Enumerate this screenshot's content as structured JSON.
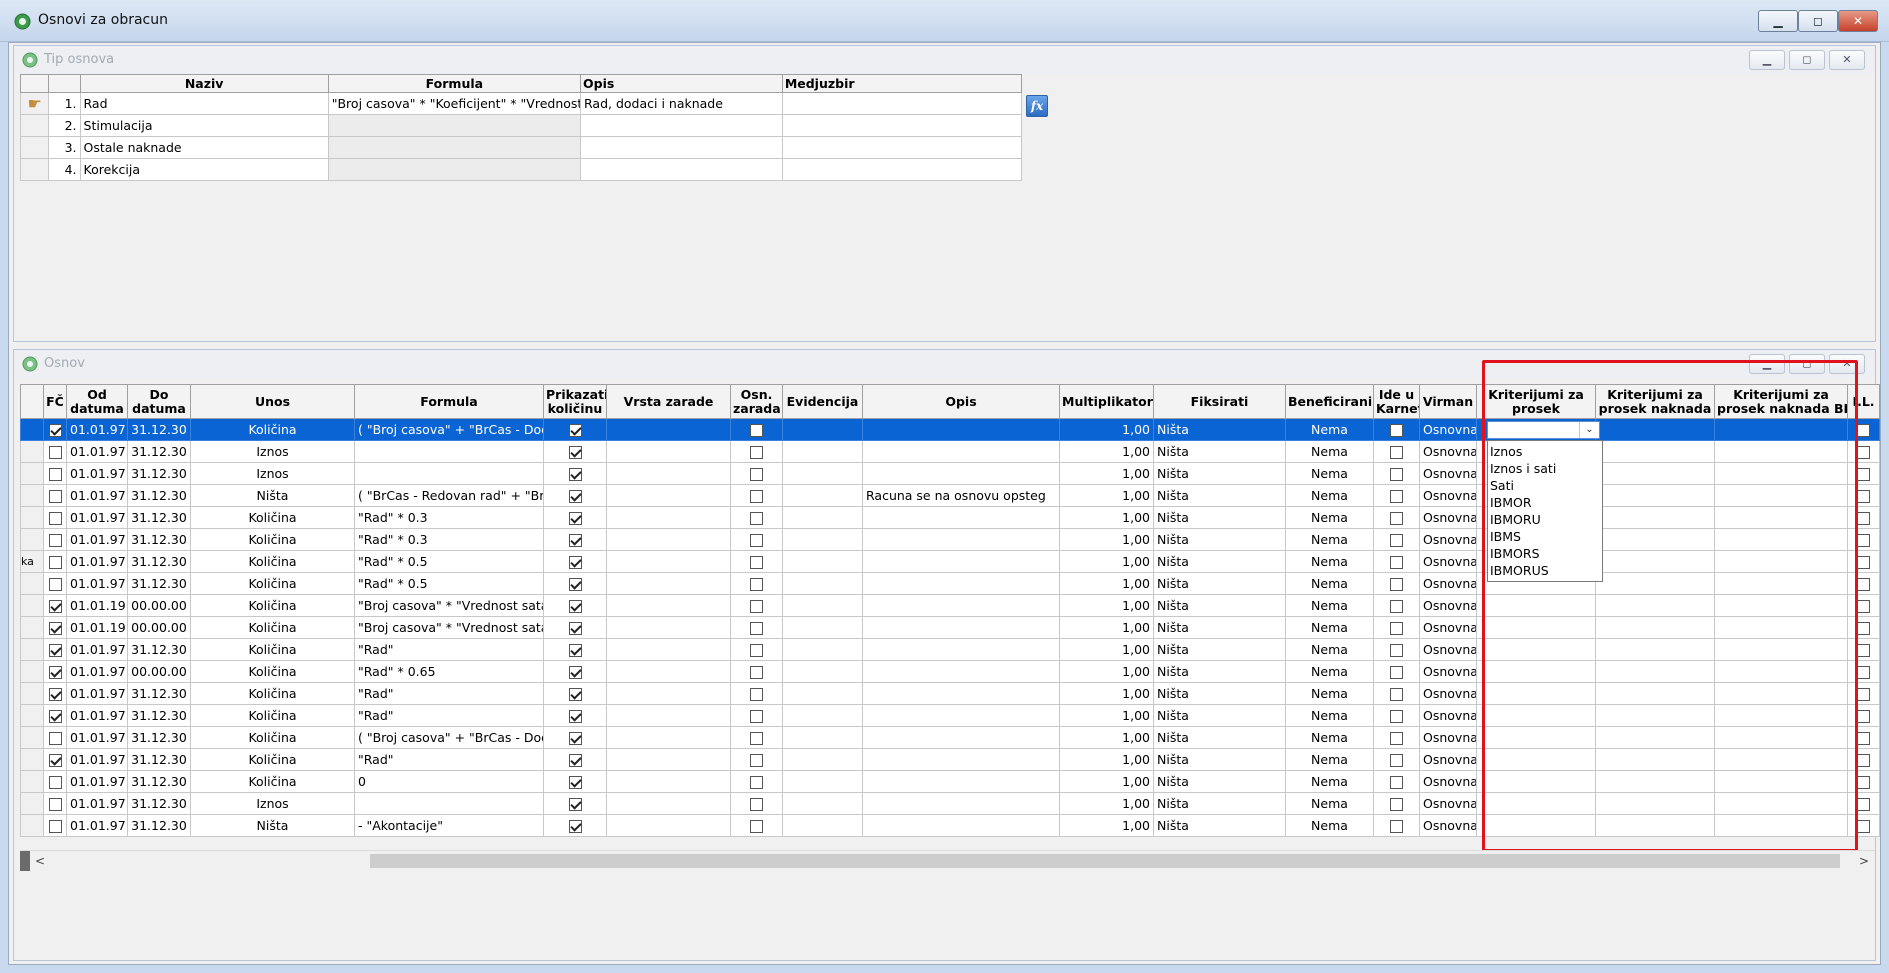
{
  "window": {
    "title": "Osnovi za obracun",
    "btn_min": "▁",
    "btn_max": "◻",
    "btn_close": "✕"
  },
  "tip_osnova": {
    "title": "Tip osnova",
    "columns": [
      "Naziv",
      "Formula",
      "Opis",
      "Medjuzbir"
    ],
    "rows": [
      {
        "num": "1.",
        "naziv": "Rad",
        "formula": "\"Broj casova\" *  \"Koeficijent\" *  \"Vrednost b",
        "opis": "Rad, dodaci i naknade",
        "medjuzbir": ""
      },
      {
        "num": "2.",
        "naziv": "Stimulacija",
        "formula": "",
        "opis": "",
        "medjuzbir": ""
      },
      {
        "num": "3.",
        "naziv": "Ostale naknade",
        "formula": "",
        "opis": "",
        "medjuzbir": ""
      },
      {
        "num": "4.",
        "naziv": "Korekcija",
        "formula": "",
        "opis": "",
        "medjuzbir": ""
      }
    ],
    "fx_label": "fx"
  },
  "osnov": {
    "title": "Osnov",
    "columns": {
      "fc": "FČ",
      "od": [
        "Od",
        "datuma"
      ],
      "do": [
        "Do",
        "datuma"
      ],
      "unos": "Unos",
      "formula": "Formula",
      "prikazati": [
        "Prikazati",
        "količinu"
      ],
      "vrsta": "Vrsta zarade",
      "osn": [
        "Osn.",
        "zarada"
      ],
      "evidencija": "Evidencija",
      "opis": "Opis",
      "multiplikator": "Multiplikator",
      "fiksirati": "Fiksirati",
      "beneficirani": "Beneficirani",
      "ide": [
        "Ide u",
        "Karnet"
      ],
      "virman": "Virman",
      "krit1": [
        "Kriterijumi za",
        "prosek"
      ],
      "krit2": [
        "Kriterijumi za",
        "prosek naknada"
      ],
      "krit3": [
        "Kriterijumi za",
        "prosek naknada BD"
      ],
      "il": "I.L."
    },
    "rows": [
      {
        "fc": true,
        "od": "01.01.97",
        "do": "31.12.30",
        "unos": "Količina",
        "formula": "(  \"Broj casova\" + \"BrCas - Dodat",
        "prik": true,
        "osn": false,
        "opis": "",
        "mult": "1,00",
        "fiks": "Ništa",
        "ben": "Nema",
        "ide": false,
        "virman": "Osnovna",
        "il": false,
        "left": ""
      },
      {
        "fc": false,
        "od": "01.01.97",
        "do": "31.12.30",
        "unos": "Iznos",
        "formula": "",
        "prik": true,
        "osn": false,
        "opis": "",
        "mult": "1,00",
        "fiks": "Ništa",
        "ben": "Nema",
        "ide": false,
        "virman": "Osnovna",
        "il": false,
        "left": ""
      },
      {
        "fc": false,
        "od": "01.01.97",
        "do": "31.12.30",
        "unos": "Iznos",
        "formula": "",
        "prik": true,
        "osn": false,
        "opis": "",
        "mult": "1,00",
        "fiks": "Ništa",
        "ben": "Nema",
        "ide": false,
        "virman": "Osnovna",
        "il": false,
        "left": ""
      },
      {
        "fc": false,
        "od": "01.01.97",
        "do": "31.12.30",
        "unos": "Ništa",
        "formula": "(  \"BrCas - Redovan rad\" + \"BrCa",
        "prik": true,
        "osn": false,
        "opis": "Racuna se na osnovu opsteg",
        "mult": "1,00",
        "fiks": "Ništa",
        "ben": "Nema",
        "ide": false,
        "virman": "Osnovna",
        "il": false,
        "left": ""
      },
      {
        "fc": false,
        "od": "01.01.97",
        "do": "31.12.30",
        "unos": "Količina",
        "formula": "\"Rad\" * 0.3",
        "prik": true,
        "osn": false,
        "opis": "",
        "mult": "1,00",
        "fiks": "Ništa",
        "ben": "Nema",
        "ide": false,
        "virman": "Osnovna",
        "il": false,
        "left": ""
      },
      {
        "fc": false,
        "od": "01.01.97",
        "do": "31.12.30",
        "unos": "Količina",
        "formula": "\"Rad\" * 0.3",
        "prik": true,
        "osn": false,
        "opis": "",
        "mult": "1,00",
        "fiks": "Ništa",
        "ben": "Nema",
        "ide": false,
        "virman": "Osnovna",
        "il": false,
        "left": ""
      },
      {
        "fc": false,
        "od": "01.01.97",
        "do": "31.12.30",
        "unos": "Količina",
        "formula": "\"Rad\" * 0.5",
        "prik": true,
        "osn": false,
        "opis": "",
        "mult": "1,00",
        "fiks": "Ništa",
        "ben": "Nema",
        "ide": false,
        "virman": "Osnovna",
        "il": false,
        "left": "ka"
      },
      {
        "fc": false,
        "od": "01.01.97",
        "do": "31.12.30",
        "unos": "Količina",
        "formula": "\"Rad\" * 0.5",
        "prik": true,
        "osn": false,
        "opis": "",
        "mult": "1,00",
        "fiks": "Ništa",
        "ben": "Nema",
        "ide": false,
        "virman": "Osnovna",
        "il": false,
        "left": ""
      },
      {
        "fc": true,
        "od": "01.01.19",
        "do": "00.00.00",
        "unos": "Količina",
        "formula": " \"Broj casova\" * \"Vrednost sata p",
        "prik": true,
        "osn": false,
        "opis": "",
        "mult": "1,00",
        "fiks": "Ništa",
        "ben": "Nema",
        "ide": false,
        "virman": "Osnovna",
        "il": false,
        "left": ""
      },
      {
        "fc": true,
        "od": "01.01.19",
        "do": "00.00.00",
        "unos": "Količina",
        "formula": " \"Broj casova\" * \"Vrednost sata p",
        "prik": true,
        "osn": false,
        "opis": "",
        "mult": "1,00",
        "fiks": "Ništa",
        "ben": "Nema",
        "ide": false,
        "virman": "Osnovna",
        "il": false,
        "left": ""
      },
      {
        "fc": true,
        "od": "01.01.97",
        "do": "31.12.30",
        "unos": "Količina",
        "formula": " \"Rad\"",
        "prik": true,
        "osn": false,
        "opis": "",
        "mult": "1,00",
        "fiks": "Ništa",
        "ben": "Nema",
        "ide": false,
        "virman": "Osnovna",
        "il": false,
        "left": ""
      },
      {
        "fc": true,
        "od": "01.01.97",
        "do": "00.00.00",
        "unos": "Količina",
        "formula": " \"Rad\" * 0.65",
        "prik": true,
        "osn": false,
        "opis": "",
        "mult": "1,00",
        "fiks": "Ništa",
        "ben": "Nema",
        "ide": false,
        "virman": "Osnovna",
        "il": false,
        "left": ""
      },
      {
        "fc": true,
        "od": "01.01.97",
        "do": "31.12.30",
        "unos": "Količina",
        "formula": "\"Rad\"",
        "prik": true,
        "osn": false,
        "opis": "",
        "mult": "1,00",
        "fiks": "Ništa",
        "ben": "Nema",
        "ide": false,
        "virman": "Osnovna",
        "il": false,
        "left": ""
      },
      {
        "fc": true,
        "od": "01.01.97",
        "do": "31.12.30",
        "unos": "Količina",
        "formula": "\"Rad\"",
        "prik": true,
        "osn": false,
        "opis": "",
        "mult": "1,00",
        "fiks": "Ništa",
        "ben": "Nema",
        "ide": false,
        "virman": "Osnovna",
        "il": false,
        "left": ""
      },
      {
        "fc": false,
        "od": "01.01.97",
        "do": "31.12.30",
        "unos": "Količina",
        "formula": "(  \"Broj casova\" + \"BrCas - Doda",
        "prik": true,
        "osn": false,
        "opis": "",
        "mult": "1,00",
        "fiks": "Ništa",
        "ben": "Nema",
        "ide": false,
        "virman": "Osnovna",
        "il": false,
        "left": ""
      },
      {
        "fc": true,
        "od": "01.01.97",
        "do": "31.12.30",
        "unos": "Količina",
        "formula": "\"Rad\"",
        "prik": true,
        "osn": false,
        "opis": "",
        "mult": "1,00",
        "fiks": "Ništa",
        "ben": "Nema",
        "ide": false,
        "virman": "Osnovna",
        "il": false,
        "left": ""
      },
      {
        "fc": false,
        "od": "01.01.97",
        "do": "31.12.30",
        "unos": "Količina",
        "formula": "0",
        "prik": true,
        "osn": false,
        "opis": "",
        "mult": "1,00",
        "fiks": "Ništa",
        "ben": "Nema",
        "ide": false,
        "virman": "Osnovna",
        "il": false,
        "left": ""
      },
      {
        "fc": false,
        "od": "01.01.97",
        "do": "31.12.30",
        "unos": "Iznos",
        "formula": "",
        "prik": true,
        "osn": false,
        "opis": "",
        "mult": "1,00",
        "fiks": "Ništa",
        "ben": "Nema",
        "ide": false,
        "virman": "Osnovna",
        "il": false,
        "left": ""
      },
      {
        "fc": false,
        "od": "01.01.97",
        "do": "31.12.30",
        "unos": "Ništa",
        "formula": "- \"Akontacije\"",
        "prik": true,
        "osn": false,
        "opis": "",
        "mult": "1,00",
        "fiks": "Ništa",
        "ben": "Nema",
        "ide": false,
        "virman": "Osnovna",
        "il": false,
        "left": ""
      }
    ],
    "dropdown_options": [
      "Iznos",
      "Iznos i sati",
      "Sati",
      "IBMOR",
      "IBMORU",
      "IBMS",
      "IBMORS",
      "IBMORUS"
    ],
    "combo_value": "",
    "combo_arrow": "⌄"
  },
  "scrollbar": {
    "left_arrow": "<",
    "right_arrow": ">"
  }
}
